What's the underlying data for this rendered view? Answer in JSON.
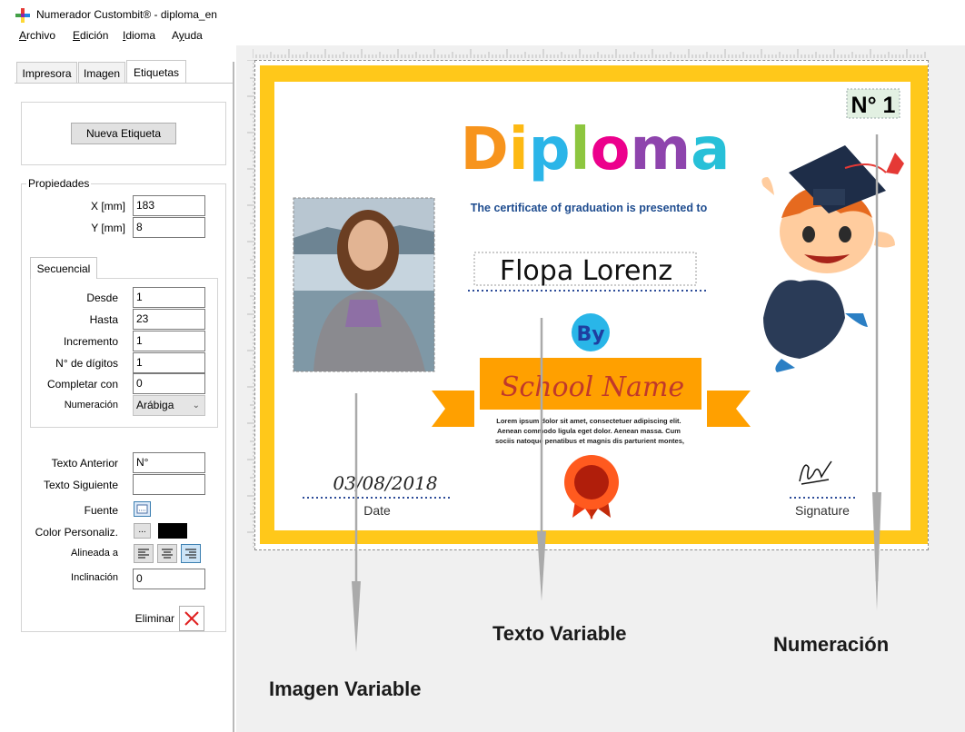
{
  "window": {
    "title": "Numerador Custombit® - diploma_en"
  },
  "menu": {
    "archivo": "Archivo",
    "edicion": "Edición",
    "idioma": "Idioma",
    "ayuda": "Ayuda"
  },
  "tabs": {
    "impresora": "Impresora",
    "imagen": "Imagen",
    "etiquetas": "Etiquetas"
  },
  "panel": {
    "nueva_etiqueta": "Nueva Etiqueta",
    "propiedades": "Propiedades",
    "x_label": "X [mm]",
    "x_value": "183",
    "y_label": "Y [mm]",
    "y_value": "8",
    "secuencial_tab": "Secuencial",
    "desde_label": "Desde",
    "desde_value": "1",
    "hasta_label": "Hasta",
    "hasta_value": "23",
    "incremento_label": "Incremento",
    "incremento_value": "1",
    "digitos_label": "N° de dígitos",
    "digitos_value": "1",
    "completar_label": "Completar con",
    "completar_value": "0",
    "numeracion_label": "Numeración",
    "numeracion_value": "Arábiga",
    "texto_anterior_label": "Texto Anterior",
    "texto_anterior_value": "N°",
    "texto_siguiente_label": "Texto Siguiente",
    "texto_siguiente_value": "",
    "fuente_label": "Fuente",
    "color_label": "Color Personaliz.",
    "color_button": "...",
    "color_swatch": "#000000",
    "alineada_label": "Alineada a",
    "inclinacion_label": "Inclinación",
    "inclinacion_value": "0",
    "eliminar_label": "Eliminar"
  },
  "diploma": {
    "number": "N° 1",
    "title_letters": [
      "D",
      "i",
      "p",
      "l",
      "o",
      "m",
      "a"
    ],
    "title_colors": [
      "#f7941d",
      "#fdb913",
      "#2bb5e8",
      "#8dc63f",
      "#ec008c",
      "#8e44ad",
      "#27c0d8"
    ],
    "subtitle": "The certificate of graduation is presented to",
    "name": "Flopa Lorenz",
    "by": "By",
    "school": "School Name",
    "lorem": [
      "Lorem ipsum dolor sit amet, consectetuer adipiscing elit.",
      "Aenean commodo ligula eget dolor. Aenean massa. Cum",
      "sociis natoque penatibus et magnis dis parturient montes,"
    ],
    "date_value": "03/08/2018",
    "date_label": "Date",
    "signature_label": "Signature"
  },
  "captions": {
    "imagen_variable": "Imagen Variable",
    "texto_variable": "Texto Variable",
    "numeracion": "Numeración"
  },
  "icons": {
    "logo": "custombit-logo-icon",
    "fuente": "font-picker-icon",
    "eliminar": "delete-x-icon"
  },
  "colors": {
    "border_yellow": "#ffc81a",
    "ribbon_orange": "#ffa000",
    "by_blue": "#29b6e8",
    "subtitle_blue": "#1e4c8f",
    "arrow_gray": "#aaaaaa"
  }
}
